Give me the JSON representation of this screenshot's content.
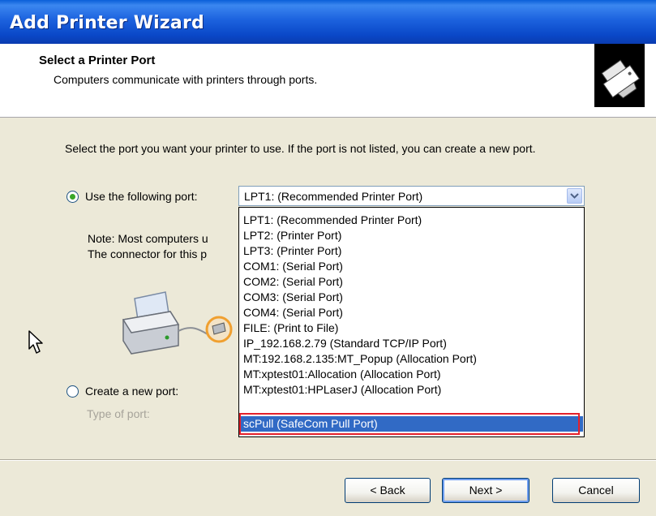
{
  "window": {
    "title": "Add Printer Wizard"
  },
  "header": {
    "title": "Select a Printer Port",
    "subtitle": "Computers communicate with printers through ports.",
    "icon": "printer-wizard-icon"
  },
  "body": {
    "instructions": "Select the port you want your printer to use.  If the port is not listed, you can create a new port.",
    "use_port_label": "Use the following port:",
    "selected_port": "LPT1: (Recommended Printer Port)",
    "note_line1": "Note: Most computers u",
    "note_line2": "The connector for this p",
    "create_port_label": "Create a new port:",
    "type_of_port_label": "Type of port:"
  },
  "dropdown": {
    "items": [
      "LPT1: (Recommended Printer Port)",
      "LPT2: (Printer Port)",
      "LPT3: (Printer Port)",
      "COM1: (Serial Port)",
      "COM2: (Serial Port)",
      "COM3: (Serial Port)",
      "COM4: (Serial Port)",
      "FILE: (Print to File)",
      "IP_192.168.2.79 (Standard TCP/IP Port)",
      "MT:192.168.2.135:MT_Popup (Allocation Port)",
      "MT:xptest01:Allocation (Allocation Port)",
      "MT:xptest01:HPLaserJ (Allocation Port)",
      "scPull (SafeCom Pull Port)"
    ],
    "selected_index": 12
  },
  "buttons": {
    "back": "< Back",
    "next": "Next >",
    "cancel": "Cancel"
  },
  "colors": {
    "titlebar": "#0a48c8",
    "selection": "#316ac5",
    "highlight_box": "#e5202a",
    "radio_dot": "#3aa628"
  }
}
